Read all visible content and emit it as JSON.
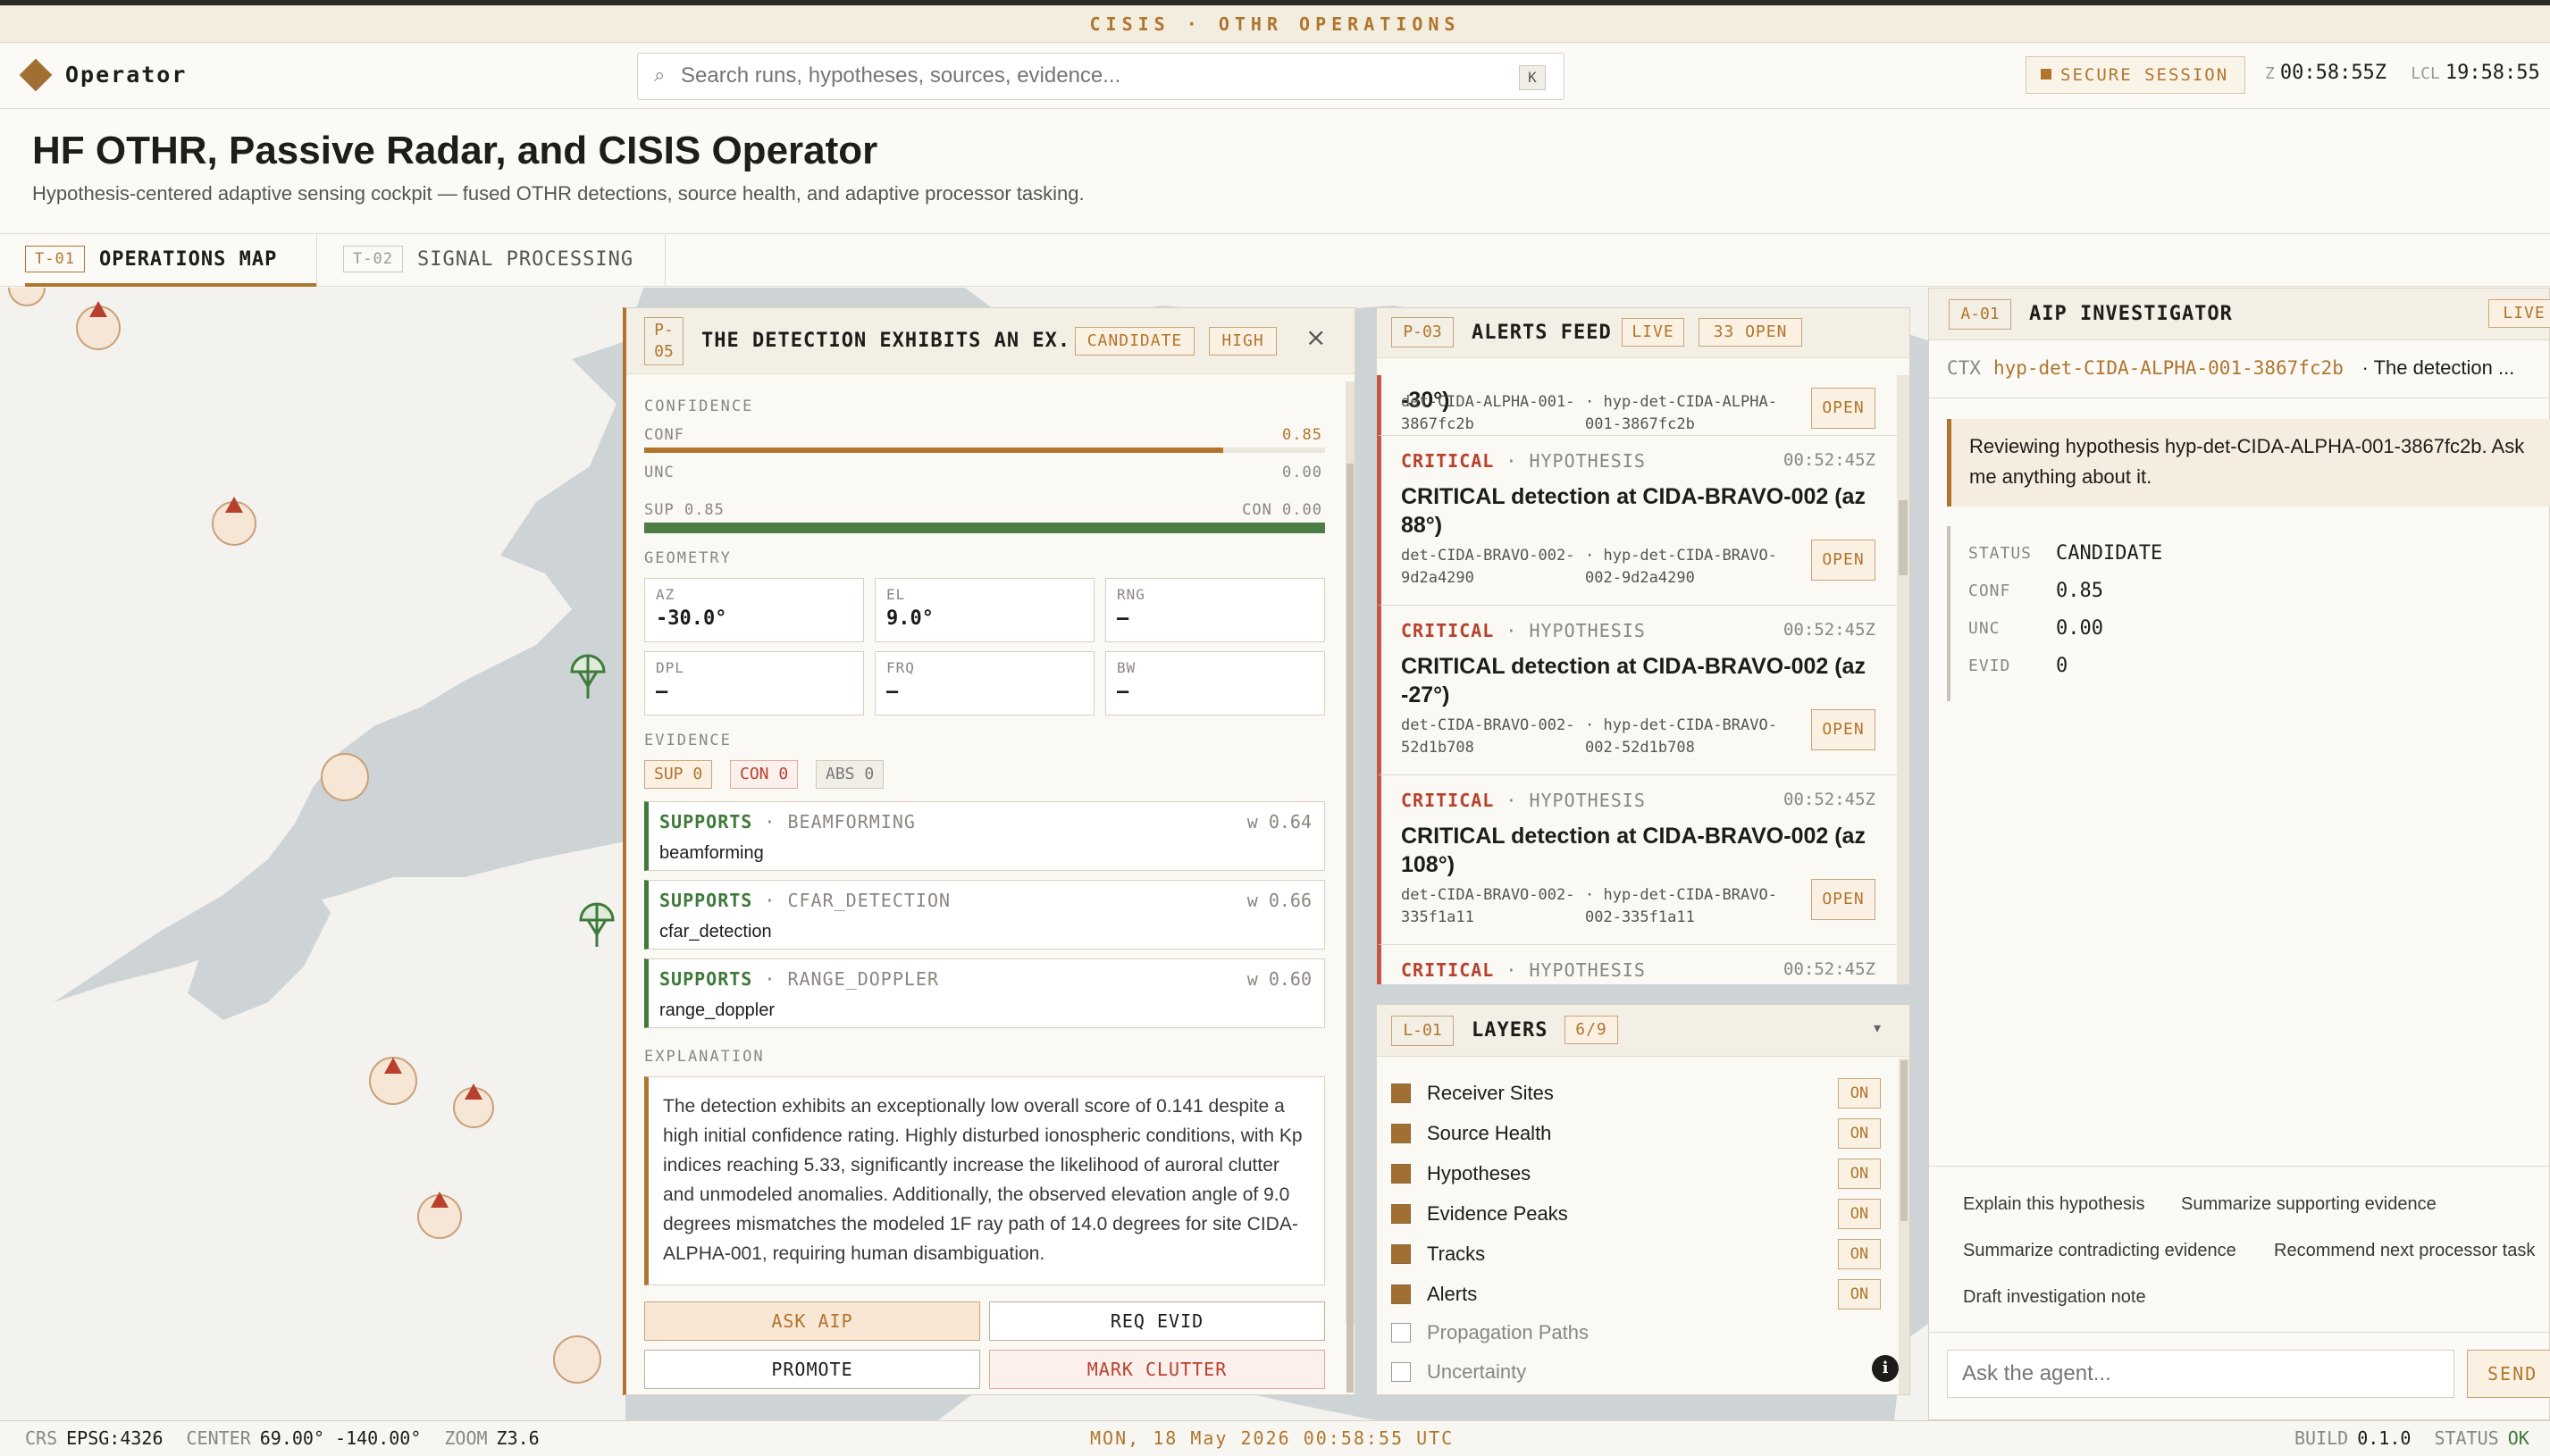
{
  "banner": "CISIS · OTHR OPERATIONS",
  "header": {
    "brand": "Operator",
    "search_placeholder": "Search runs, hypotheses, sources, evidence...",
    "search_key": "K",
    "secure_session": "SECURE SESSION",
    "zulu_label": "Z",
    "zulu_time": "00:58:55Z",
    "local_label": "LCL",
    "local_time": "19:58:55"
  },
  "page": {
    "title": "HF OTHR, Passive Radar, and CISIS Operator",
    "subtitle": "Hypothesis-centered adaptive sensing cockpit — fused OTHR detections, source health, and adaptive processor tasking."
  },
  "tabs": [
    {
      "code": "T-01",
      "label": "OPERATIONS MAP",
      "active": true
    },
    {
      "code": "T-02",
      "label": "SIGNAL PROCESSING",
      "active": false
    }
  ],
  "detail": {
    "code": "P-05",
    "title": "THE DETECTION EXHIBITS AN EX...",
    "status": "CANDIDATE",
    "priority": "HIGH",
    "confidence_label": "CONFIDENCE",
    "conf_label": "CONF",
    "conf": "0.85",
    "conf_value": 0.85,
    "unc_label": "UNC",
    "unc": "0.00",
    "sup_label": "SUP 0.85",
    "con_label": "CON 0.00",
    "sup_fraction": 1.0,
    "geometry_label": "GEOMETRY",
    "geometry": [
      {
        "k": "AZ",
        "v": "-30.0°"
      },
      {
        "k": "EL",
        "v": "9.0°"
      },
      {
        "k": "RNG",
        "v": "—"
      },
      {
        "k": "DPL",
        "v": "—"
      },
      {
        "k": "FRQ",
        "v": "—"
      },
      {
        "k": "BW",
        "v": "—"
      }
    ],
    "evidence_label": "EVIDENCE",
    "evidence_counts": {
      "sup": "SUP 0",
      "con": "CON 0",
      "abs": "ABS 0"
    },
    "evidence": [
      {
        "kind": "SUPPORTS",
        "source": "BEAMFORMING",
        "weight": "w 0.64",
        "desc": "beamforming"
      },
      {
        "kind": "SUPPORTS",
        "source": "CFAR_DETECTION",
        "weight": "w 0.66",
        "desc": "cfar_detection"
      },
      {
        "kind": "SUPPORTS",
        "source": "RANGE_DOPPLER",
        "weight": "w 0.60",
        "desc": "range_doppler"
      }
    ],
    "explanation_label": "EXPLANATION",
    "explanation": "The detection exhibits an exceptionally low overall score of 0.141 despite a high initial confidence rating. Highly disturbed ionospheric conditions, with Kp indices reaching 5.33, significantly increase the likelihood of auroral clutter and unmodeled anomalies. Additionally, the observed elevation angle of 9.0 degrees mismatches the modeled 1F ray path of 14.0 degrees for site CIDA-ALPHA-001, requiring human disambiguation.",
    "actions": {
      "ask": "ASK AIP",
      "req": "REQ EVID",
      "promote": "PROMOTE",
      "clutter": "MARK CLUTTER"
    }
  },
  "alerts": {
    "code": "P-03",
    "title": "ALERTS FEED",
    "live": "LIVE",
    "open_count": "33 OPEN",
    "partial_top": {
      "title_tail": "-30°)",
      "id1": "det-CIDA-ALPHA-001-3867fc2b",
      "id2": "· hyp-det-CIDA-ALPHA-001-3867fc2b",
      "open": "OPEN"
    },
    "items": [
      {
        "severity": "CRITICAL",
        "kind": "· HYPOTHESIS",
        "time": "00:52:45Z",
        "title": "CRITICAL detection at CIDA-BRAVO-002 (az 88°)",
        "id1": "det-CIDA-BRAVO-002-9d2a4290",
        "id2": "· hyp-det-CIDA-BRAVO-002-9d2a4290",
        "open": "OPEN"
      },
      {
        "severity": "CRITICAL",
        "kind": "· HYPOTHESIS",
        "time": "00:52:45Z",
        "title": "CRITICAL detection at CIDA-BRAVO-002 (az -27°)",
        "id1": "det-CIDA-BRAVO-002-52d1b708",
        "id2": "· hyp-det-CIDA-BRAVO-002-52d1b708",
        "open": "OPEN"
      },
      {
        "severity": "CRITICAL",
        "kind": "· HYPOTHESIS",
        "time": "00:52:45Z",
        "title": "CRITICAL detection at CIDA-BRAVO-002 (az 108°)",
        "id1": "det-CIDA-BRAVO-002-335f1a11",
        "id2": "· hyp-det-CIDA-BRAVO-002-335f1a11",
        "open": "OPEN"
      },
      {
        "severity": "CRITICAL",
        "kind": "· HYPOTHESIS",
        "time": "00:52:45Z",
        "title": "",
        "id1": "",
        "id2": "",
        "open": ""
      }
    ]
  },
  "layers": {
    "code": "L-01",
    "title": "LAYERS",
    "count": "6/9",
    "items": [
      {
        "name": "Receiver Sites",
        "on": true,
        "state": "ON"
      },
      {
        "name": "Source Health",
        "on": true,
        "state": "ON"
      },
      {
        "name": "Hypotheses",
        "on": true,
        "state": "ON"
      },
      {
        "name": "Evidence Peaks",
        "on": true,
        "state": "ON"
      },
      {
        "name": "Tracks",
        "on": true,
        "state": "ON"
      },
      {
        "name": "Alerts",
        "on": true,
        "state": "ON"
      },
      {
        "name": "Propagation Paths",
        "on": false,
        "state": ""
      },
      {
        "name": "Uncertainty",
        "on": false,
        "state": ""
      }
    ]
  },
  "investigator": {
    "code": "A-01",
    "title": "AIP INVESTIGATOR",
    "live": "LIVE",
    "ctx_label": "CTX",
    "ctx_id": "hyp-det-CIDA-ALPHA-001-3867fc2b",
    "ctx_desc": "· The detection ...",
    "message": "Reviewing hypothesis hyp-det-CIDA-ALPHA-001-3867fc2b. Ask me anything about it.",
    "stats": [
      {
        "k": "STATUS",
        "v": "CANDIDATE"
      },
      {
        "k": "CONF",
        "v": "0.85"
      },
      {
        "k": "UNC",
        "v": "0.00"
      },
      {
        "k": "EVID",
        "v": "0"
      }
    ],
    "suggestions": [
      "Explain this hypothesis",
      "Summarize supporting evidence",
      "Summarize contradicting evidence",
      "Recommend next processor task",
      "Draft investigation note"
    ],
    "ask_placeholder": "Ask the agent...",
    "send": "SEND"
  },
  "status_bar": {
    "crs_label": "CRS",
    "crs": "EPSG:4326",
    "center_label": "CENTER",
    "center": "69.00° -140.00°",
    "zoom_label": "ZOOM",
    "zoom": "Z3.6",
    "datetime": "MON, 18 May 2026 00:58:55 UTC",
    "build_label": "BUILD",
    "build": "0.1.0",
    "status_label": "STATUS",
    "status": "OK"
  },
  "colors": {
    "accent": "#b0752d",
    "critical": "#b8402d",
    "supports": "#3f7a3b",
    "land": "#f3f2ee",
    "sea": "#ced3d6"
  }
}
